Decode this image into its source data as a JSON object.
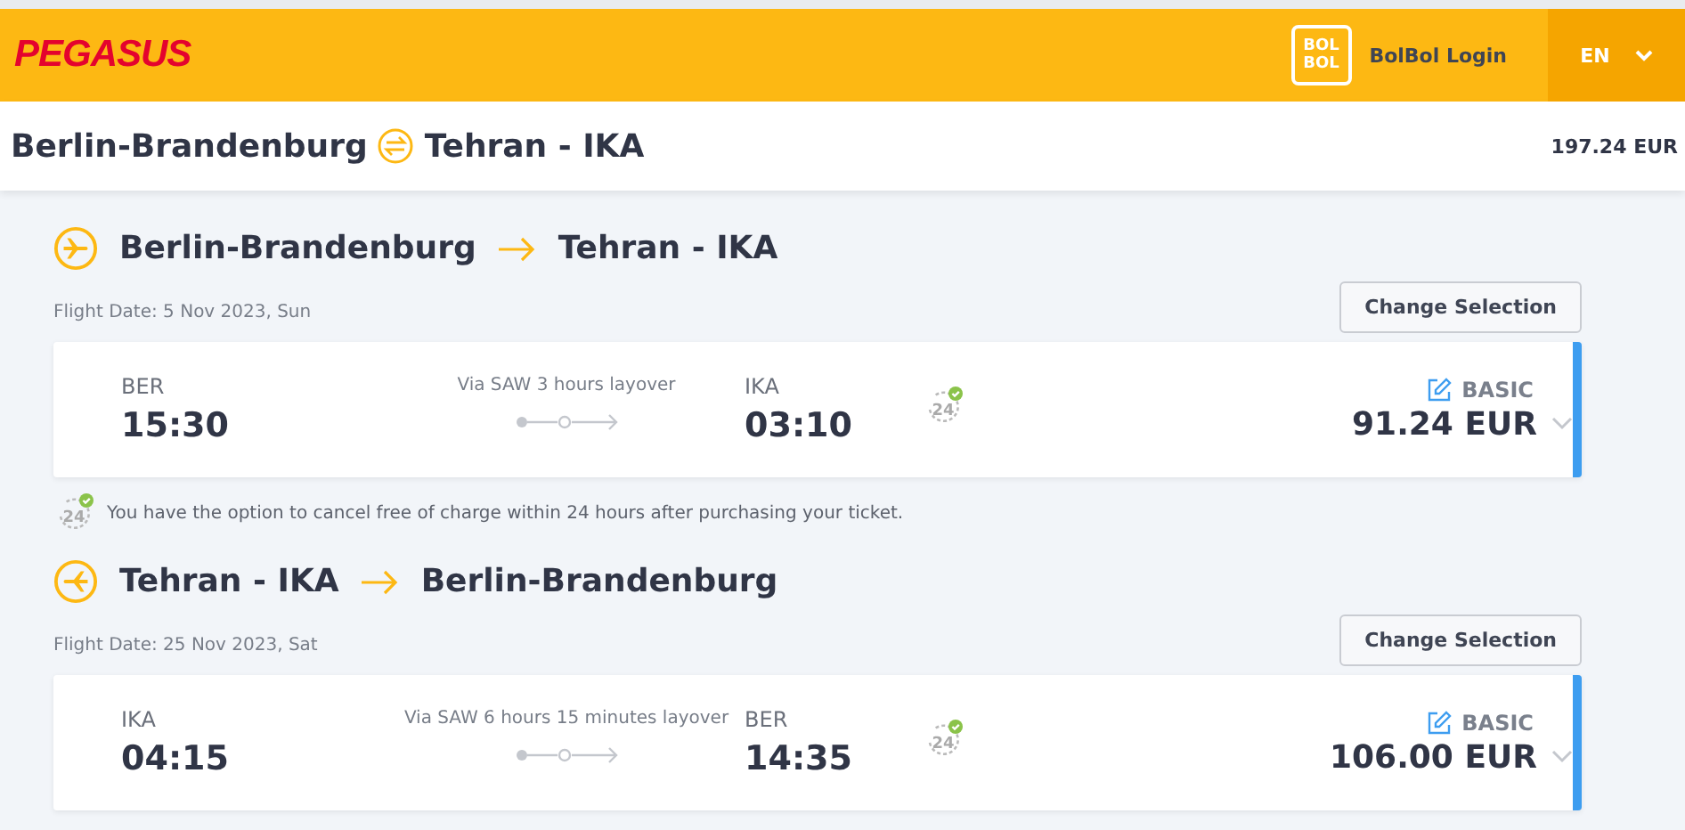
{
  "header": {
    "logo": "PEGASUS",
    "loyalty_logo": [
      "BOL",
      "BOL"
    ],
    "login": "BolBol Login",
    "language": "EN"
  },
  "summary": {
    "origin": "Berlin-Brandenburg",
    "destination": "Tehran - IKA",
    "total": "197.24 EUR"
  },
  "flights": [
    {
      "kind": "outbound",
      "origin": "Berlin-Brandenburg",
      "destination": "Tehran - IKA",
      "date": "Flight Date: 5 Nov 2023, Sun",
      "button": "Change Selection",
      "dep_code": "BER",
      "dep_time": "15:30",
      "layover": "Via SAW 3 hours layover",
      "arr_code": "IKA",
      "arr_time": "03:10",
      "badge": "24",
      "fare": "BASIC",
      "price": "91.24 EUR",
      "note": {
        "badge": "24",
        "text": "You have the option to cancel free of charge within 24 hours after purchasing your ticket."
      }
    },
    {
      "kind": "return",
      "origin": "Tehran - IKA",
      "destination": "Berlin-Brandenburg",
      "date": "Flight Date: 25 Nov 2023, Sat",
      "button": "Change Selection",
      "dep_code": "IKA",
      "dep_time": "04:15",
      "layover": "Via SAW 6 hours 15 minutes layover",
      "arr_code": "BER",
      "arr_time": "14:35",
      "badge": "24",
      "fare": "BASIC",
      "price": "106.00 EUR"
    }
  ]
}
